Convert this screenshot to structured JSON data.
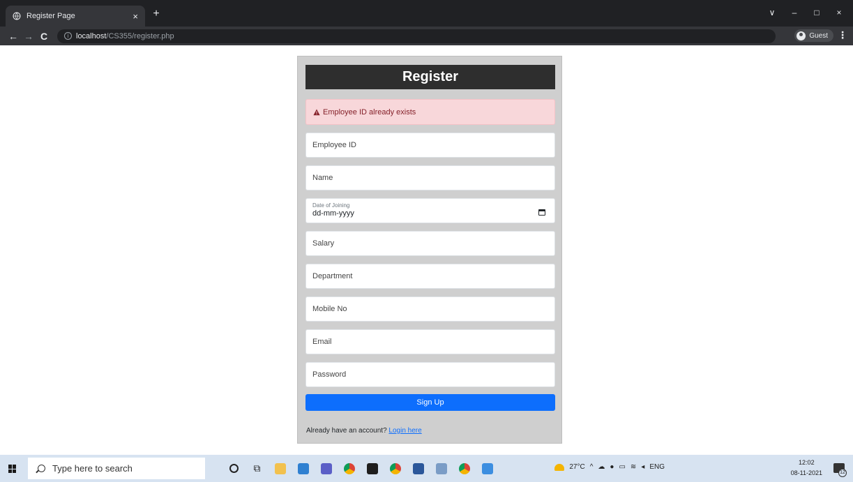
{
  "browser": {
    "tab_title": "Register Page",
    "tab_close": "×",
    "new_tab": "+",
    "url_host": "localhost",
    "url_path": "/CS355/register.php",
    "profile_label": "Guest",
    "window_controls": {
      "tabs_menu": "∨",
      "minimize": "–",
      "maximize": "□",
      "close": "×"
    }
  },
  "form": {
    "title": "Register",
    "error_message": "Employee ID already exists",
    "fields": {
      "employee_id": "Employee ID",
      "name": "Name",
      "date_label": "Date of Joining",
      "date_placeholder": "dd-mm-yyyy",
      "salary": "Salary",
      "department": "Department",
      "mobile": "Mobile No",
      "email": "Email",
      "password": "Password"
    },
    "submit_label": "Sign Up",
    "footer_text": "Already have an account?",
    "footer_link": "Login here"
  },
  "taskbar": {
    "search_placeholder": "Type here to search",
    "temperature": "27°C",
    "language": "ENG",
    "time": "12:02",
    "date": "08-11-2021",
    "notification_count": "12"
  },
  "colors": {
    "header_bg": "#2e2e2e",
    "alert_bg": "#f8d7da",
    "alert_text": "#842029",
    "button_bg": "#0d6efd",
    "card_bg": "#cfcfcf"
  }
}
